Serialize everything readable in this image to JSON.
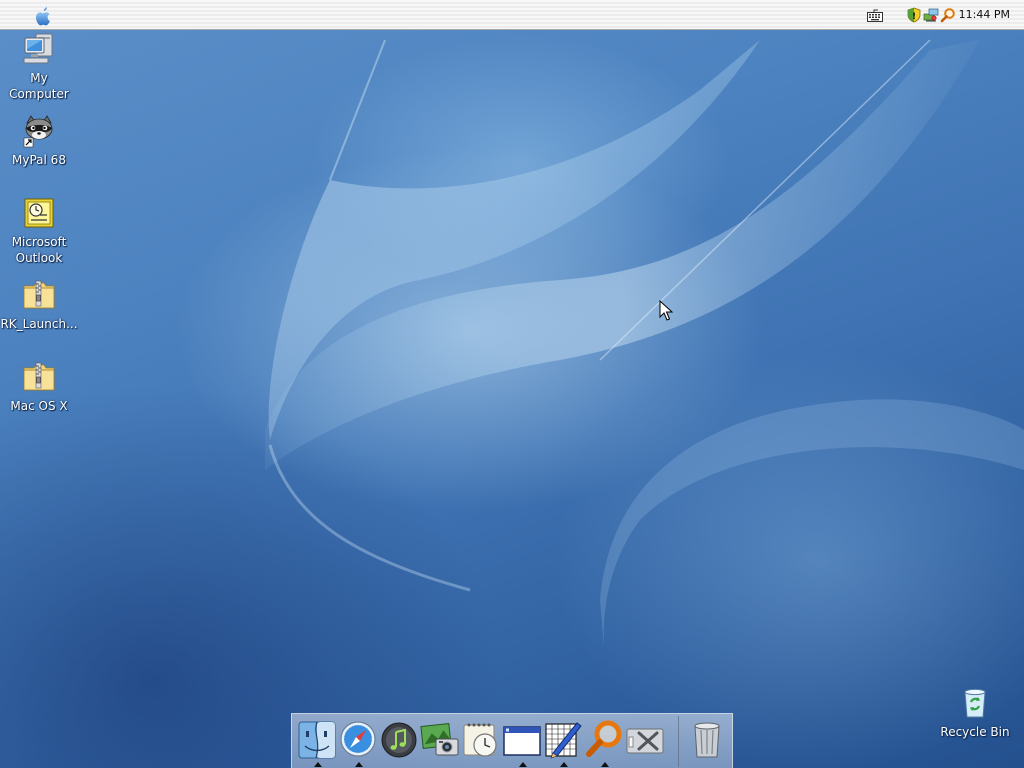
{
  "menubar": {
    "clock": "11:44 PM"
  },
  "desktop_icons": [
    {
      "label": "My Computer"
    },
    {
      "label": "MyPal 68"
    },
    {
      "label": "Microsoft Outlook"
    },
    {
      "label": "RK_Launch..."
    },
    {
      "label": "Mac OS X"
    },
    {
      "label": "Recycle Bin"
    }
  ],
  "dock": {
    "items": [
      "finder-icon",
      "safari-icon",
      "itunes-icon",
      "iphoto-icon",
      "ical-icon",
      "window-icon",
      "textedit-icon",
      "sherlock-icon",
      "utilities-icon",
      "trash-icon"
    ]
  },
  "colors": {
    "desktop_blue": "#3f73b3",
    "menubar": "#f3f3f3"
  }
}
